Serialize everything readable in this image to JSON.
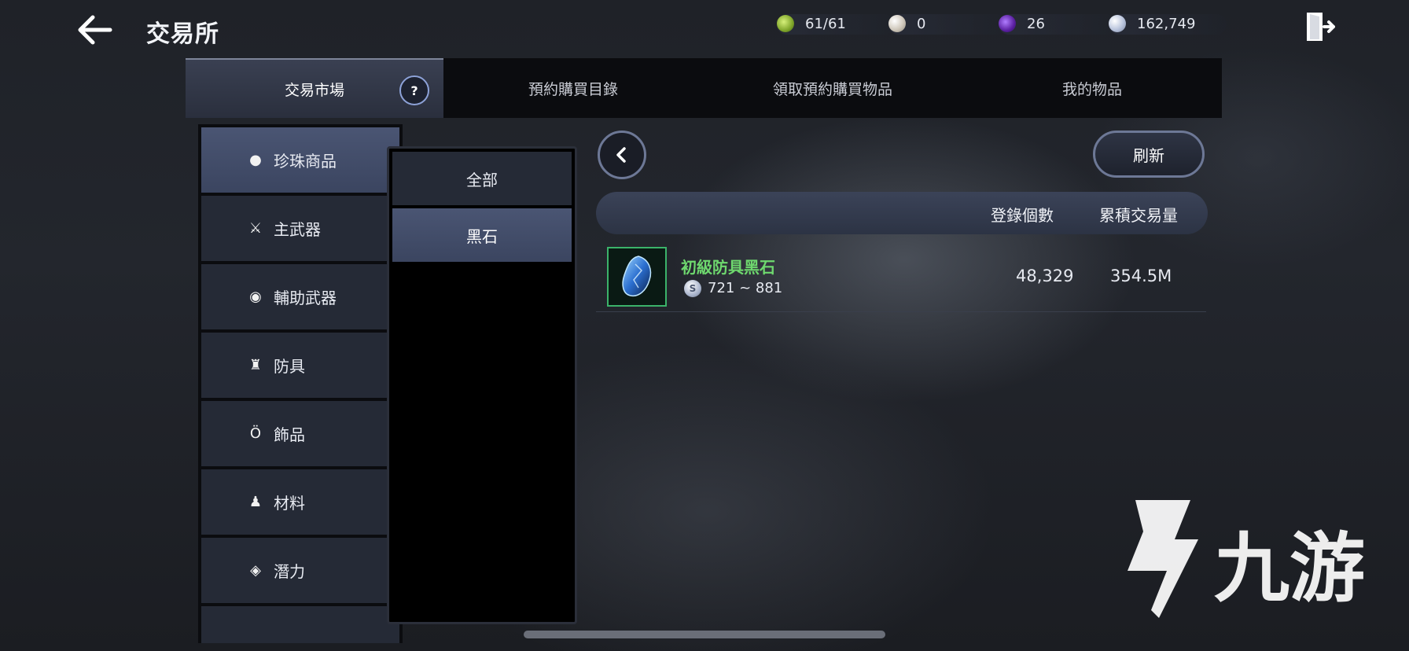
{
  "header": {
    "title": "交易所",
    "currencies": [
      {
        "name": "energy",
        "value": "61/61",
        "color": "#8fbf3a"
      },
      {
        "name": "pearl",
        "value": "0",
        "color": "#d8d2c8"
      },
      {
        "name": "dark-crystal",
        "value": "26",
        "color": "#6a2fb0"
      },
      {
        "name": "silver",
        "value": "162,749",
        "color": "#c7d1e6"
      }
    ]
  },
  "tabs": [
    {
      "label": "交易市場",
      "active": true
    },
    {
      "label": "預約購買目錄",
      "active": false
    },
    {
      "label": "領取預約購買物品",
      "active": false
    },
    {
      "label": "我的物品",
      "active": false
    }
  ],
  "help_icon": "?",
  "categories": [
    {
      "label": "珍珠商品",
      "icon": "pearl-icon",
      "active": true
    },
    {
      "label": "主武器",
      "icon": "crossed-swords-icon",
      "active": false
    },
    {
      "label": "輔助武器",
      "icon": "ring-target-icon",
      "active": false
    },
    {
      "label": "防具",
      "icon": "armor-icon",
      "active": false
    },
    {
      "label": "飾品",
      "icon": "ring-icon",
      "active": false
    },
    {
      "label": "材料",
      "icon": "potion-icon",
      "active": false
    },
    {
      "label": "潛力",
      "icon": "diamond-arrow-icon",
      "active": false
    }
  ],
  "subcategories": [
    {
      "label": "全部",
      "active": false
    },
    {
      "label": "黑石",
      "active": true
    }
  ],
  "refresh_label": "刷新",
  "table": {
    "columns": [
      "登錄個數",
      "累積交易量"
    ],
    "rows": [
      {
        "name": "初級防具黑石",
        "price_range": "721 ~ 881",
        "count": "48,329",
        "volume": "354.5M",
        "name_color": "#6ed86e"
      }
    ]
  },
  "watermark": {
    "text": "九游"
  }
}
